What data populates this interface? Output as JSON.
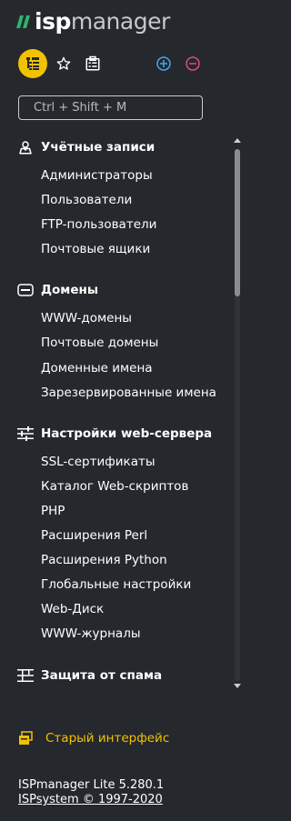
{
  "brand": {
    "logo_bold": "isp",
    "logo_light": "manager"
  },
  "toolbar": {
    "tree_icon": "tree-view-icon",
    "star_icon": "star-icon",
    "clipboard_icon": "clipboard-icon",
    "expand_icon": "plus-circle-icon",
    "collapse_icon": "minus-circle-icon"
  },
  "search": {
    "placeholder": "Ctrl + Shift + M",
    "value": ""
  },
  "menu": {
    "groups": [
      {
        "icon": "user-pin-icon",
        "label": "Учётные записи",
        "items": [
          "Администраторы",
          "Пользователи",
          "FTP-пользователи",
          "Почтовые ящики"
        ]
      },
      {
        "icon": "www-icon",
        "label": "Домены",
        "items": [
          "WWW-домены",
          "Почтовые домены",
          "Доменные имена",
          "Зарезервированные имена"
        ]
      },
      {
        "icon": "sliders-icon",
        "label": "Настройки web-сервера",
        "items": [
          "SSL-сертификаты",
          "Каталог Web-скриптов",
          "PHP",
          "Расширения Perl",
          "Расширения Python",
          "Глобальные настройки",
          "Web-Диск",
          "WWW-журналы"
        ]
      },
      {
        "icon": "filter-bars-icon",
        "label": "Защита от спама",
        "items": []
      }
    ]
  },
  "old_interface": {
    "icon": "old-window-icon",
    "label": "Старый интерфейс"
  },
  "footer": {
    "version": "ISPmanager Lite 5.280.1",
    "copyright": "ISPsystem © 1997-2020"
  },
  "colors": {
    "background": "#25282d",
    "accent_yellow": "#f2c200",
    "logo_green": "#2fb46e",
    "plus_blue": "#3fa9f5",
    "minus_pink": "#e5487e"
  }
}
